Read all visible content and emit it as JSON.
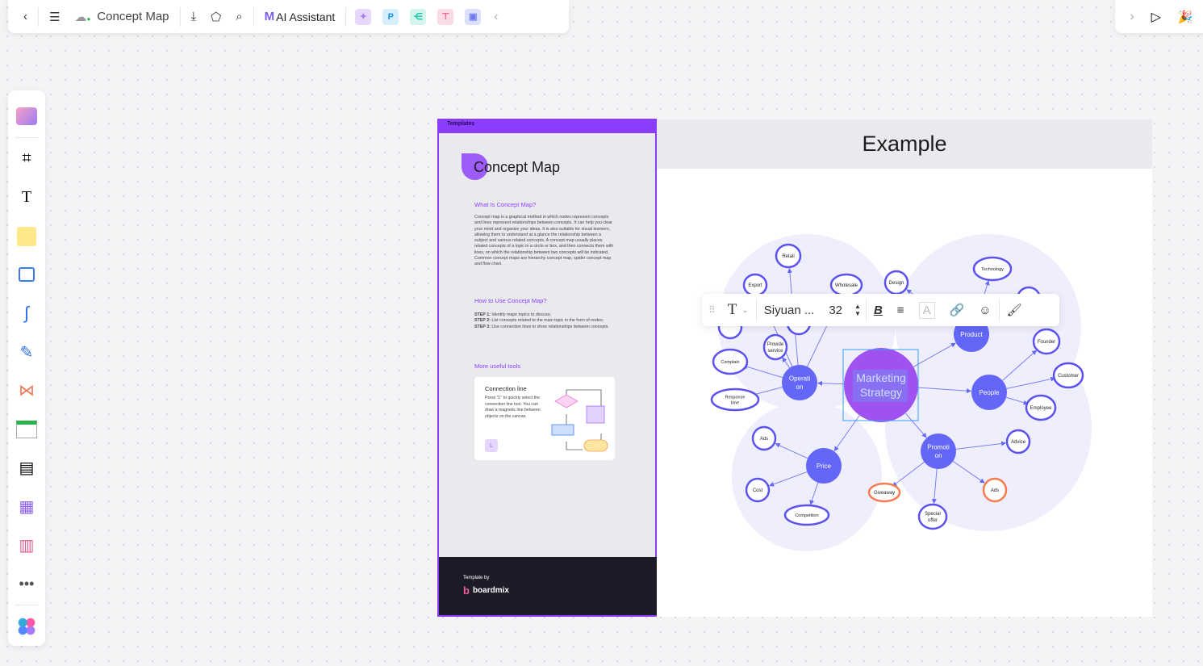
{
  "topbar": {
    "title": "Concept Map",
    "ai_label": "AI Assistant",
    "apps": [
      {
        "icon": "image-ai-icon",
        "color": "#e7d8fb",
        "fg": "#a77ef0",
        "glyph": "✦"
      },
      {
        "icon": "p-app-icon",
        "color": "#d7eefc",
        "fg": "#1e8fe8",
        "glyph": "P"
      },
      {
        "icon": "mindmap-app-icon",
        "color": "#d2f5ee",
        "fg": "#17c2a8",
        "glyph": "⋲"
      },
      {
        "icon": "flow-app-icon",
        "color": "#fbdbe7",
        "fg": "#ef5a8d",
        "glyph": "⊤"
      },
      {
        "icon": "chat-app-icon",
        "color": "#dde0fb",
        "fg": "#6f7af0",
        "glyph": "▣"
      }
    ]
  },
  "panel": {
    "header": "Templates",
    "title": "Concept Map",
    "what_heading": "What Is Concept Map?",
    "what_body": "Concept map is a graphical method in which nodes represent concepts and lines represent relationships between concepts. It can help you clear your mind and organize your ideas. It is also suitable for visual learners, allowing them to understand at a glance the relationship between a subject and various related concepts. A concept map usually places related concepts of a topic in a circle or box, and then connects them with lines, on which the relationship between two concepts will be indicated. Common concept maps are hierarchy concept map, spider concept map and flow chart.",
    "how_heading": "How to Use Concept Map?",
    "steps": [
      {
        "label": "STEP 1:",
        "text": "Identify major topics to discuss;"
      },
      {
        "label": "STEP 2:",
        "text": "List concepts related to the main topic in the form of nodes;"
      },
      {
        "label": "STEP 3:",
        "text": "Use connection lines to show relationships between concepts."
      }
    ],
    "tools_heading": "More useful tools",
    "card_title": "Connection line",
    "card_body": "Press \"L\" to quickly select the connection line tool. You can draw a magnetic line between objects on the canvas.",
    "card_key": "L",
    "footer_label": "Template by",
    "brand": "boardmix"
  },
  "example": {
    "title": "Example"
  },
  "format_toolbar": {
    "font": "Siyuan ...",
    "size": "32"
  },
  "map": {
    "center": "Marketing Strategy",
    "hubs": [
      "Operati on",
      "Product",
      "People",
      "Price",
      "Promoti on"
    ],
    "leaves": [
      "Retail",
      "Export",
      "Wholesale",
      "Design",
      "Technology",
      "Provide service",
      "Complain",
      "Response time",
      "Founder",
      "Customer",
      "Employee",
      "Ads",
      "Cost",
      "Competition",
      "Giveaway",
      "Ads",
      "Special offer",
      "Advice"
    ],
    "colors": {
      "center": "#a052f0",
      "hub": "#6366f6",
      "leaf_border": "#5b52f0",
      "highlight": "#f97a4e",
      "blob": "#eeeefc"
    }
  }
}
